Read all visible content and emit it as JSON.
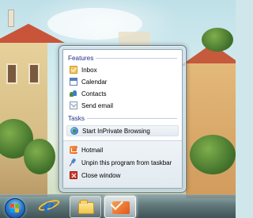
{
  "jump_list": {
    "sections": {
      "features": {
        "header": "Features",
        "items": [
          {
            "label": "Inbox",
            "icon": "inbox-icon"
          },
          {
            "label": "Calendar",
            "icon": "calendar-icon"
          },
          {
            "label": "Contacts",
            "icon": "contacts-icon"
          },
          {
            "label": "Send email",
            "icon": "send-email-icon"
          }
        ]
      },
      "tasks": {
        "header": "Tasks",
        "items": [
          {
            "label": "Start InPrivate Browsing",
            "icon": "inprivate-icon"
          }
        ]
      }
    },
    "footer": {
      "items": [
        {
          "label": "Hotmail",
          "icon": "hotmail-icon"
        },
        {
          "label": "Unpin this program from taskbar",
          "icon": "unpin-icon"
        },
        {
          "label": "Close window",
          "icon": "close-window-icon"
        }
      ]
    }
  },
  "taskbar": {
    "buttons": [
      {
        "name": "start-button",
        "icon": "windows-logo-icon"
      },
      {
        "name": "internet-explorer",
        "icon": "ie-icon"
      },
      {
        "name": "windows-explorer",
        "icon": "folder-icon"
      },
      {
        "name": "windows-live-mail",
        "icon": "mail-icon"
      }
    ]
  },
  "colors": {
    "section_header": "#1e3287",
    "taskbar": "#465f69",
    "accent_orange": "#e2561c"
  }
}
